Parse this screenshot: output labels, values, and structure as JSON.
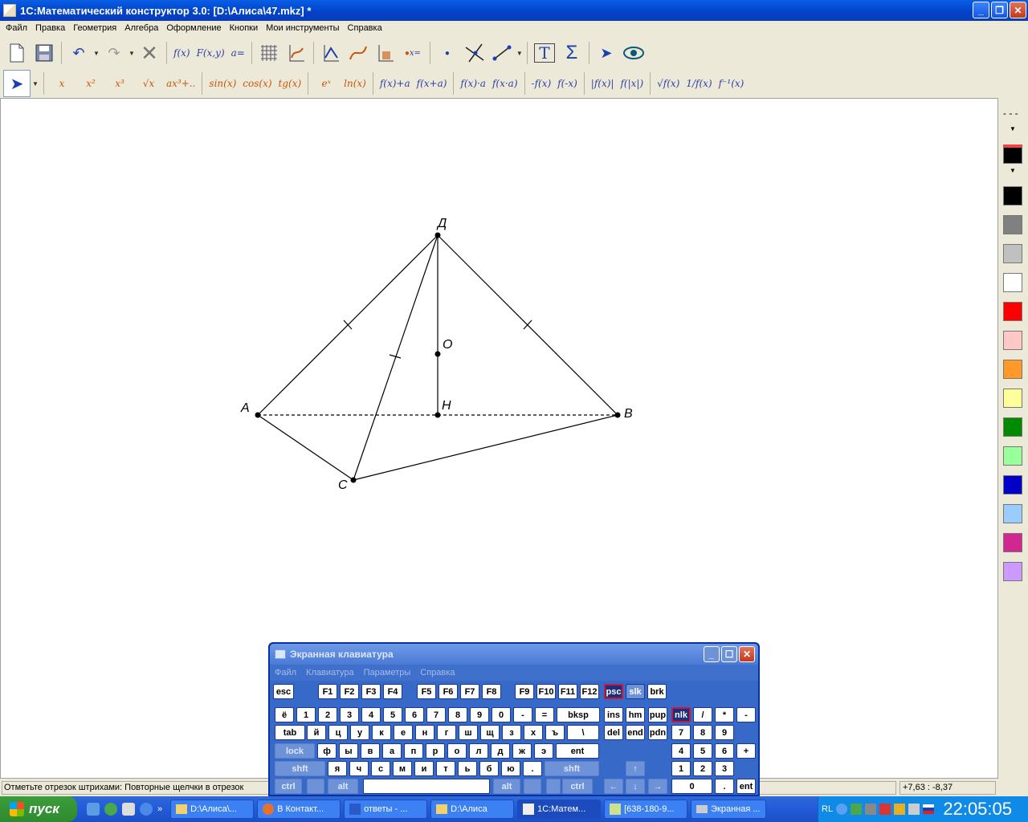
{
  "window": {
    "title": "1С:Математический конструктор 3.0: [D:\\Алиса\\47.mkz] *"
  },
  "menu": [
    "Файл",
    "Правка",
    "Геометрия",
    "Алгебра",
    "Оформление",
    "Кнопки",
    "Мои инструменты",
    "Справка"
  ],
  "toolbar1": {
    "func_labels": [
      "f(x)",
      "F(x,y)",
      "a="
    ],
    "sigma": "Σ",
    "text_tool": "T"
  },
  "toolbar2": {
    "functions_orange": [
      "x",
      "x²",
      "x³",
      "√x",
      "ax³+..",
      "sin(x)",
      "cos(x)",
      "tg(x)",
      "eˣ",
      "ln(x)"
    ],
    "functions_blue": [
      "f(x)+a",
      "f(x+a)",
      "f(x)·a",
      "f(x·a)",
      "-f(x)",
      "f(-x)",
      "|f(x)|",
      "f(|x|)",
      "√f(x)",
      "1/f(x)",
      "f⁻¹(x)"
    ]
  },
  "geometry": {
    "points": [
      {
        "name": "А",
        "label": "A"
      },
      {
        "name": "В",
        "label": "B"
      },
      {
        "name": "С",
        "label": "C"
      },
      {
        "name": "Д",
        "label": "Д"
      },
      {
        "name": "О",
        "label": "O"
      },
      {
        "name": "Н",
        "label": "H"
      }
    ]
  },
  "right_panel": {
    "line_style": "- - -",
    "colors": [
      "#000000",
      "#808080",
      "#c0c0c0",
      "#ffffff",
      "#ff0000",
      "#ffc8c8",
      "#ff9a2a",
      "#ffff99",
      "#008a00",
      "#99ff99",
      "#0000c8",
      "#99ccff",
      "#d02890",
      "#cc99ff"
    ]
  },
  "status": {
    "hint": "Отметьте отрезок штрихами: Повторные щелчки в отрезок",
    "coords": "+7,63 : -8,37"
  },
  "osk": {
    "title": "Экранная клавиатура",
    "menu": [
      "Файл",
      "Клавиатура",
      "Параметры",
      "Справка"
    ],
    "row_fn": [
      "esc",
      "F1",
      "F2",
      "F3",
      "F4",
      "F5",
      "F6",
      "F7",
      "F8",
      "F9",
      "F10",
      "F11",
      "F12",
      "psc",
      "slk",
      "brk"
    ],
    "row1": [
      "ё",
      "1",
      "2",
      "3",
      "4",
      "5",
      "6",
      "7",
      "8",
      "9",
      "0",
      "-",
      "=",
      "bksp",
      "ins",
      "hm",
      "pup",
      "nlk",
      "/",
      "*",
      "-"
    ],
    "row2": [
      "tab",
      "й",
      "ц",
      "у",
      "к",
      "е",
      "н",
      "г",
      "ш",
      "щ",
      "з",
      "х",
      "ъ",
      "\\",
      "del",
      "end",
      "pdn",
      "7",
      "8",
      "9"
    ],
    "row3": [
      "lock",
      "ф",
      "ы",
      "в",
      "а",
      "п",
      "р",
      "о",
      "л",
      "д",
      "ж",
      "э",
      "ent",
      "4",
      "5",
      "6",
      "+"
    ],
    "row4": [
      "shft",
      "я",
      "ч",
      "с",
      "м",
      "и",
      "т",
      "ь",
      "б",
      "ю",
      ".",
      "shft",
      "1",
      "2",
      "3"
    ],
    "row5": [
      "ctrl",
      "alt",
      "alt",
      "ctrl",
      "0",
      ".",
      "ent"
    ]
  },
  "taskbar": {
    "start": "пуск",
    "tasks": [
      "D:\\Алиса\\...",
      "В Контакт...",
      "ответы - ...",
      "D:\\Алиса",
      "1С:Матем...",
      "[638-180-9...",
      "Экранная ..."
    ],
    "lang": "RL",
    "clock": "22:05:05"
  }
}
